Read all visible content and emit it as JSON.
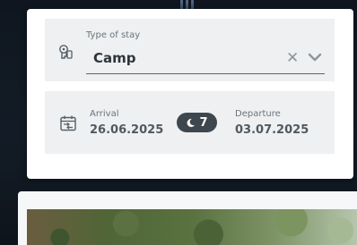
{
  "booking": {
    "stay_type": {
      "label": "Type of stay",
      "value": "Camp",
      "clear_symbol": "✕"
    },
    "dates": {
      "arrival_label": "Arrival",
      "arrival_value": "26.06.2025",
      "departure_label": "Departure",
      "departure_value": "03.07.2025",
      "nights": "7"
    }
  },
  "icons": {
    "stay_type": "tag-keys-icon",
    "calendar": "calendar-icon",
    "clear": "clear-icon",
    "dropdown": "chevron-down-icon",
    "nights": "moon-icon"
  },
  "colors": {
    "field_background": "#eef0f1",
    "text_dark": "#2e353b",
    "nights_pill": "#3f474e"
  }
}
